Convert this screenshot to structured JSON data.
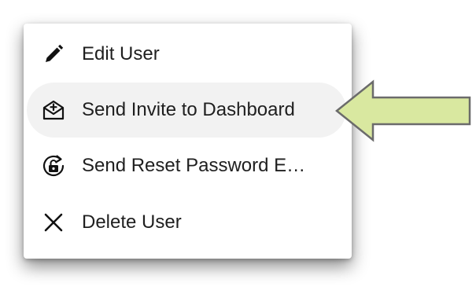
{
  "menu": {
    "items": [
      {
        "label": "Edit User",
        "icon": "pencil-icon"
      },
      {
        "label": "Send Invite to Dashboard",
        "icon": "mail-invite-icon"
      },
      {
        "label": "Send Reset Password E…",
        "icon": "reset-password-icon"
      },
      {
        "label": "Delete User",
        "icon": "close-icon"
      }
    ],
    "hovered_index": 1
  },
  "colors": {
    "menu_background": "#ffffff",
    "hover_background": "#f2f2f2",
    "text": "#1f1f1f",
    "arrow_fill": "#d9e8a0",
    "arrow_stroke": "#6b6b6b"
  }
}
